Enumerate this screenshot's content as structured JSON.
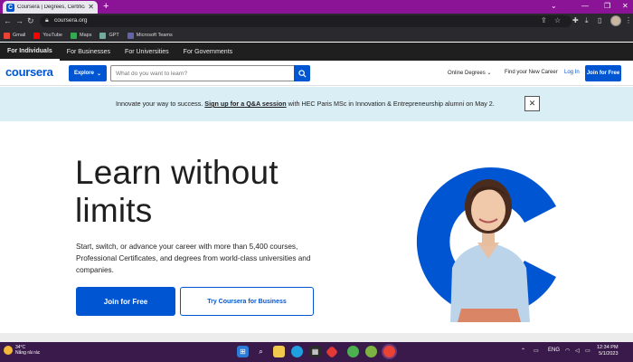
{
  "browser": {
    "tab_title": "Coursera | Degrees, Certificates, & F",
    "url": "coursera.org",
    "bookmarks": [
      {
        "label": "Gmail",
        "color": "#ea4335"
      },
      {
        "label": "YouTube",
        "color": "#ff0000"
      },
      {
        "label": "Maps",
        "color": "#34a853"
      },
      {
        "label": "GPT",
        "color": "#74aa9c"
      },
      {
        "label": "Microsoft Teams",
        "color": "#6264a7"
      }
    ]
  },
  "audience_nav": [
    "For Individuals",
    "For Businesses",
    "For Universities",
    "For Governments"
  ],
  "header": {
    "logo": "coursera",
    "explore_label": "Explore",
    "search_placeholder": "What do you want to learn?",
    "online_degrees": "Online Degrees",
    "find_career": "Find your New Career",
    "login": "Log In",
    "join": "Join for Free"
  },
  "banner": {
    "prefix": "Innovate your way to success. ",
    "link": "Sign up for a Q&A session",
    "suffix": " with HEC Paris MSc in Innovation & Entrepreneurship alumni on May 2."
  },
  "hero": {
    "title": "Learn without limits",
    "subtitle": "Start, switch, or advance your career with more than 5,400 courses, Professional Certificates, and degrees from world-class universities and companies.",
    "join_button": "Join for Free",
    "business_button": "Try Coursera for Business"
  },
  "taskbar": {
    "temp": "34°C",
    "weather": "Nắng rải rác",
    "lang": "ENG",
    "time": "12:34 PM",
    "date": "5/1/2023"
  },
  "colors": {
    "brand": "#0056d2",
    "chrome_frame": "#8a1396",
    "banner_bg": "#daeef5"
  }
}
